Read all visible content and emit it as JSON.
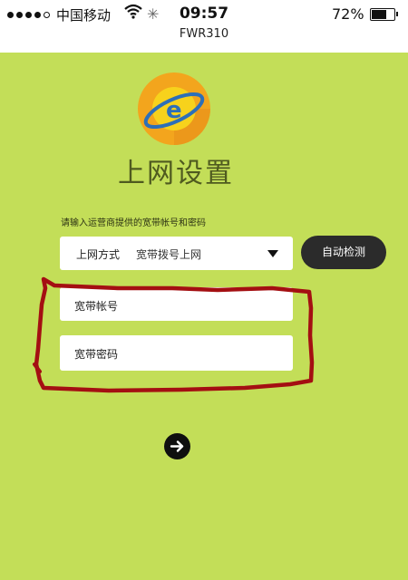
{
  "status_bar": {
    "carrier": "中国移动",
    "time": "09:57",
    "battery": "72%",
    "battery_level": 0.72,
    "device_name": "FWR310"
  },
  "icons": {
    "signal": "signal-strength-icon",
    "wifi": "wifi-icon",
    "activity": "activity-spinner-icon",
    "battery": "battery-icon",
    "logo": "internet-globe-logo-icon",
    "dropdown": "dropdown-caret-icon",
    "next": "arrow-right-icon"
  },
  "page": {
    "title": "上网设置",
    "instruction": "请输入运营商提供的宽带帐号和密码"
  },
  "form": {
    "connection_type_label": "上网方式",
    "connection_type_value": "宽带拨号上网",
    "detect_button": "自动检测",
    "account_label": "宽带帐号",
    "account_value": "",
    "password_label": "宽带密码",
    "password_value": ""
  },
  "colors": {
    "background": "#c3de58",
    "title": "#4f5a1f",
    "highlight_mark": "#a40f12",
    "button_dark": "#2b2b2b"
  }
}
